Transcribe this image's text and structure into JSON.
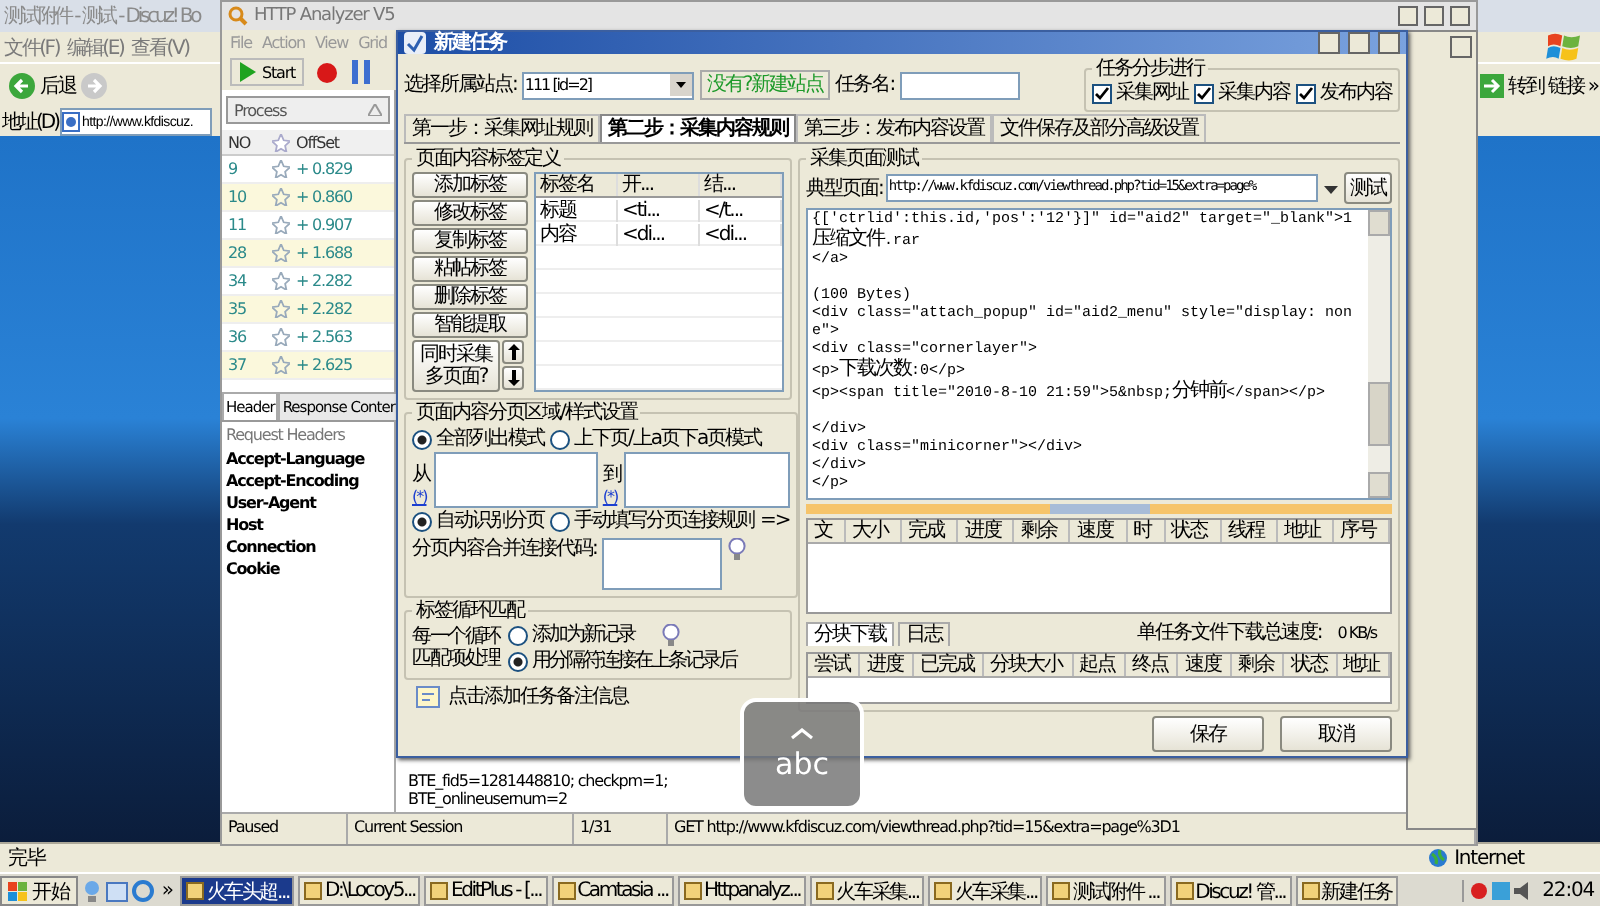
{
  "browser": {
    "title": "测试附件 - 测试 - Discuz! Bo",
    "menu": [
      "文件(F)",
      "编辑(E)",
      "查看(V)"
    ],
    "back": "后退",
    "address_label": "地址(D)",
    "address": "http://www.kfdiscuz.",
    "go": "转到",
    "links": "链接",
    "more": "»",
    "status": "完毕",
    "zone": "Internet"
  },
  "analyzer": {
    "title": "HTTP Analyzer V5",
    "menu": [
      "File",
      "Action",
      "View",
      "Grid"
    ],
    "start": "Start",
    "process_filter": "Process",
    "columns": [
      "NO",
      "OffSet"
    ],
    "rows": [
      {
        "no": "9",
        "offset": "+ 0.829"
      },
      {
        "no": "10",
        "offset": "+ 0.860"
      },
      {
        "no": "11",
        "offset": "+ 0.907"
      },
      {
        "no": "28",
        "offset": "+ 1.688"
      },
      {
        "no": "34",
        "offset": "+ 2.282"
      },
      {
        "no": "35",
        "offset": "+ 2.282"
      },
      {
        "no": "36",
        "offset": "+ 2.563"
      },
      {
        "no": "37",
        "offset": "+ 2.625"
      }
    ],
    "tabs": [
      {
        "label": "Header",
        "selected": true
      },
      {
        "label": "Response Conter",
        "selected": false
      }
    ],
    "headers_title": "Request Headers",
    "headers": [
      "Accept-Language",
      "Accept-Encoding",
      "User-Agent",
      "Host",
      "Connection",
      "Cookie"
    ],
    "cookie_value": [
      "BTE_fid5=1281448810; checkpm=1;",
      "BTE_onlineusernum=2"
    ],
    "status": [
      "Paused",
      "Current Session",
      "1/31",
      "GET http://www.kfdiscuz.com/viewthread.php?tid=15&extra=page%3D1"
    ]
  },
  "dialog": {
    "title": "新建任务",
    "site_label": "选择所属站点:",
    "site": "111 [id=2]",
    "new_site": "没有?新建站点",
    "task_name_label": "任务名:",
    "steps_title": "任务分步进行",
    "steps": [
      {
        "label": "采集网址",
        "checked": true
      },
      {
        "label": "采集内容",
        "checked": true
      },
      {
        "label": "发布内容",
        "checked": true
      }
    ],
    "tabs": [
      {
        "label": "第一步：采集网址规则",
        "selected": false
      },
      {
        "label": "第二步：采集内容规则",
        "selected": true
      },
      {
        "label": "第三步：发布内容设置",
        "selected": false
      },
      {
        "label": "文件保存及部分高级设置",
        "selected": false
      }
    ],
    "tags": {
      "title": "页面内容标签定义",
      "buttons": [
        "添加标签",
        "修改标签",
        "复制标签",
        "粘帖标签",
        "删除标签",
        "智能提取"
      ],
      "multi_page": "同时采集多页面?",
      "columns": [
        "标签名",
        "开...",
        "结..."
      ],
      "rows": [
        [
          "标题",
          "<ti...",
          "</t..."
        ],
        [
          "内容",
          "<di...",
          "<di..."
        ]
      ]
    },
    "paging": {
      "title": "页面内容分页区域/样式设置",
      "modes": [
        {
          "label": "全部列出模式",
          "selected": true
        },
        {
          "label": "上下页/上a页下a页模式",
          "selected": false
        }
      ],
      "from": {
        "label": "从",
        "marker": "(*)"
      },
      "to": {
        "label": "到",
        "marker": "(*)"
      },
      "detect": [
        {
          "label": "自动识别分页",
          "selected": true
        },
        {
          "label": "手动填写分页连接规则",
          "selected": false
        }
      ],
      "arrow": "=>",
      "merge_label": "分页内容合并连接代码:"
    },
    "loop": {
      "title": "标签循环匹配",
      "label": "每一个循环匹配项处理",
      "options": [
        {
          "label": "添加为新记录",
          "selected": false
        },
        {
          "label": "用分隔符连接在上条记录后",
          "selected": true
        }
      ]
    },
    "note": "点击添加任务备注信息",
    "test": {
      "title": "采集页面测试",
      "page_label": "典型页面:",
      "url": "http://www.kfdiscuz.com/viewthread.php?tid=15&extra=page%",
      "test_button": "测试",
      "code": "{['ctrlid':this.id,'pos':'12'}]\" id=\"aid2\" target=\"_blank\">1压缩文件.rar\n</a>\n\n(100 Bytes)\n<div class=\"attach_popup\" id=\"aid2_menu\" style=\"display: none\">\n<div class=\"cornerlayer\">\n<p>下载次数:0</p>\n<p><span title=\"2010-8-10 21:59\">5&nbsp;分钟前</span></p>\n\n</div>\n<div class=\"minicorner\"></div>\n</div>\n</p>",
      "task_columns": [
        "文",
        "大小",
        "完成",
        "进度",
        "剩余",
        "速度",
        "时",
        "状态",
        "线程",
        "地址",
        "序号"
      ],
      "sub_tabs": [
        {
          "label": "分块下载",
          "selected": true
        },
        {
          "label": "日志",
          "selected": false
        }
      ],
      "speed_label": "单任务文件下载总速度:",
      "speed": "0 KB/s",
      "block_columns": [
        "尝试",
        "进度",
        "已完成",
        "分块大小",
        "起点",
        "终点",
        "速度",
        "剩余",
        "状态",
        "地址"
      ]
    },
    "buttons": [
      "保存",
      "取消"
    ]
  },
  "overlay": {
    "text": "abc"
  },
  "taskbar": {
    "start": "开始",
    "more": "»",
    "clock": "22:04",
    "tasks": [
      {
        "label": "火车头超...",
        "selected": true
      },
      {
        "label": "D:\\Locoy5...",
        "selected": false
      },
      {
        "label": "EditPlus - [...",
        "selected": false
      },
      {
        "label": "Camtasia ...",
        "selected": false
      },
      {
        "label": "Httpanalyz...",
        "selected": false
      },
      {
        "label": "火车采集...",
        "selected": false
      },
      {
        "label": "火车采集...",
        "selected": false
      },
      {
        "label": "测试附件 ...",
        "selected": false
      },
      {
        "label": "Discuz! 管...",
        "selected": false
      },
      {
        "label": "新建任务",
        "selected": false
      }
    ]
  }
}
